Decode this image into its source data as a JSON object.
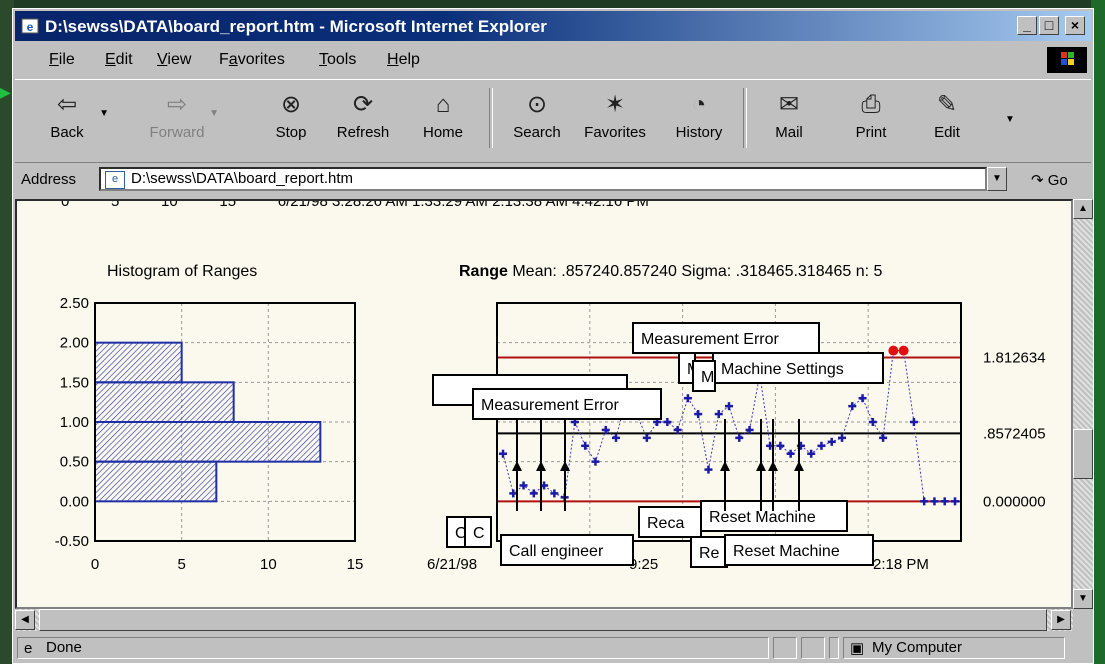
{
  "window": {
    "title": "D:\\sewss\\DATA\\board_report.htm - Microsoft Internet Explorer",
    "buttons": [
      "_",
      "□",
      "×"
    ]
  },
  "menu": {
    "items": [
      {
        "pre": "",
        "u": "F",
        "post": "ile"
      },
      {
        "pre": "",
        "u": "E",
        "post": "dit"
      },
      {
        "pre": "",
        "u": "V",
        "post": "iew"
      },
      {
        "pre": "F",
        "u": "a",
        "post": "vorites"
      },
      {
        "pre": "",
        "u": "T",
        "post": "ools"
      },
      {
        "pre": "",
        "u": "H",
        "post": "elp"
      }
    ]
  },
  "toolbar": {
    "back": "Back",
    "forward": "Forward",
    "stop": "Stop",
    "refresh": "Refresh",
    "home": "Home",
    "search": "Search",
    "favorites": "Favorites",
    "history": "History",
    "mail": "Mail",
    "print": "Print",
    "edit": "Edit"
  },
  "address": {
    "label": "Address",
    "value": "D:\\sewss\\DATA\\board_report.htm",
    "go": "Go"
  },
  "content": {
    "top_clipped_text": "0          5          10          15          6/21/98 3:28:26 AM 1:33:29 AM 2:13:38 AM 4:42:16 PM",
    "histogram_title": "Histogram of Ranges",
    "range_heading_bold": "Range",
    "range_heading_rest": " Mean: .857240.857240 Sigma: .318465.318465 n: 5"
  },
  "chart_data": [
    {
      "type": "bar",
      "orientation": "horizontal",
      "title": "Histogram of Ranges",
      "categories": [
        2.0,
        1.5,
        1.0,
        0.5,
        0.0
      ],
      "values": [
        5,
        8,
        13,
        7,
        0
      ],
      "bins": [
        {
          "from": 1.5,
          "to": 2.0,
          "count": 5
        },
        {
          "from": 1.0,
          "to": 1.5,
          "count": 8
        },
        {
          "from": 0.5,
          "to": 1.0,
          "count": 13
        },
        {
          "from": 0.0,
          "to": 0.5,
          "count": 7
        }
      ],
      "xlim": [
        0,
        15
      ],
      "ylim": [
        -0.5,
        2.5
      ],
      "x_ticks": [
        "0",
        "5",
        "10",
        "15"
      ],
      "y_ticks": [
        "2.50",
        "2.00",
        "1.50",
        "1.00",
        "0.50",
        "0.00",
        "-0.50"
      ],
      "grid": true,
      "colors": {
        "bar_edge": "#1f2fa6",
        "hatch": "#1f2fa6"
      }
    },
    {
      "type": "line",
      "title": "Range",
      "ylim": [
        -0.5,
        2.5
      ],
      "control_lines": [
        {
          "label": "1.812634",
          "value": 1.812634,
          "color": "#b01010"
        },
        {
          "label": ".8572405",
          "value": 0.8572405,
          "color": "#000000"
        },
        {
          "label": "0.000000",
          "value": 0.0,
          "color": "#b01010"
        }
      ],
      "x_tick_left": "6/21/98",
      "x_tick_mid": "9:25",
      "x_tick_right": "2:18 PM",
      "values": [
        0.6,
        0.1,
        0.2,
        0.1,
        0.2,
        0.1,
        0.05,
        1.0,
        0.7,
        0.5,
        0.9,
        0.8,
        1.3,
        1.1,
        0.8,
        1.0,
        1.0,
        0.9,
        1.3,
        1.1,
        0.4,
        1.1,
        1.2,
        0.8,
        0.9,
        1.6,
        0.7,
        0.7,
        0.6,
        0.7,
        0.6,
        0.7,
        0.75,
        0.8,
        1.2,
        1.3,
        1.0,
        0.8,
        1.9,
        1.9,
        1.0,
        0.0,
        0.0,
        0.0,
        0.0
      ],
      "out_of_control_points": [
        38,
        39
      ],
      "colors": {
        "points": "#1a1aa6",
        "out_of_control": "#e01010",
        "line": "#3a3ac0"
      },
      "annotations": [
        "Measurement Error",
        "M",
        "Machine Settings",
        "M",
        "Measurement Error",
        "C",
        "C",
        "Call engineer",
        "Reca",
        "Reset Machine",
        "Re",
        "Reset Machine"
      ]
    }
  ],
  "status": {
    "left": "Done",
    "zone": "My Computer"
  }
}
